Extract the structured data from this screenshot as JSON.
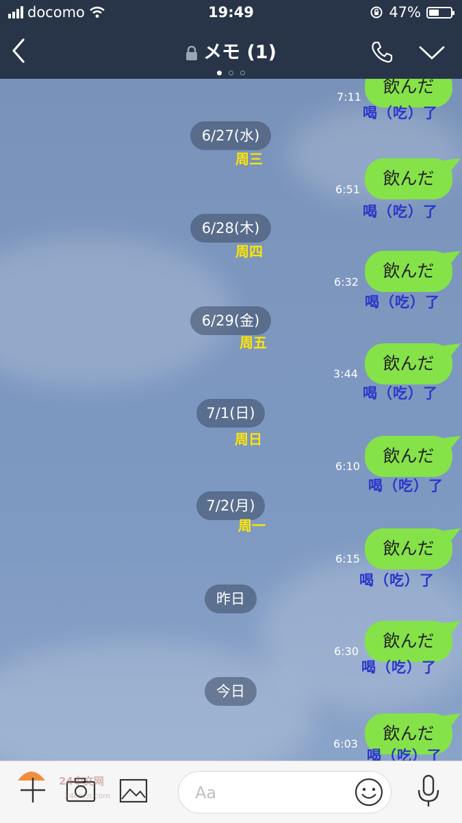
{
  "status_bar": {
    "carrier": "docomo",
    "time": "19:49",
    "battery": "47%",
    "battery_level": 0.47
  },
  "header": {
    "title": "メモ (1)",
    "page_dots": 3,
    "active_dot": 0
  },
  "messages": [
    {
      "time": "7:11",
      "text": "飲んだ",
      "translation": "喝（吃）了"
    },
    {
      "date": "6/27(水)",
      "date_cn": "周三"
    },
    {
      "time": "6:51",
      "text": "飲んだ",
      "translation": "喝（吃）了"
    },
    {
      "date": "6/28(木)",
      "date_cn": "周四"
    },
    {
      "time": "6:32",
      "text": "飲んだ",
      "translation": "喝（吃）了"
    },
    {
      "date": "6/29(金)",
      "date_cn": "周五"
    },
    {
      "time": "3:44",
      "text": "飲んだ",
      "translation": "喝（吃）了"
    },
    {
      "date": "7/1(日)",
      "date_cn": "周日"
    },
    {
      "time": "6:10",
      "text": "飲んだ",
      "translation": "喝（吃）了"
    },
    {
      "date": "7/2(月)",
      "date_cn": "周一"
    },
    {
      "time": "6:15",
      "text": "飲んだ",
      "translation": "喝（吃）了"
    },
    {
      "date": "昨日"
    },
    {
      "time": "6:30",
      "text": "飲んだ",
      "translation": "喝（吃）了"
    },
    {
      "date": "今日"
    },
    {
      "time": "6:03",
      "text": "飲んだ",
      "translation": "喝（吃）了"
    }
  ],
  "input": {
    "placeholder": "Aa"
  },
  "watermark": {
    "text": "24中文网",
    "sub": "24cncn.com"
  },
  "colors": {
    "bubble": "#85e249",
    "header": "#283549",
    "translation": "#2a35c9",
    "date_cn": "#ffe600"
  }
}
